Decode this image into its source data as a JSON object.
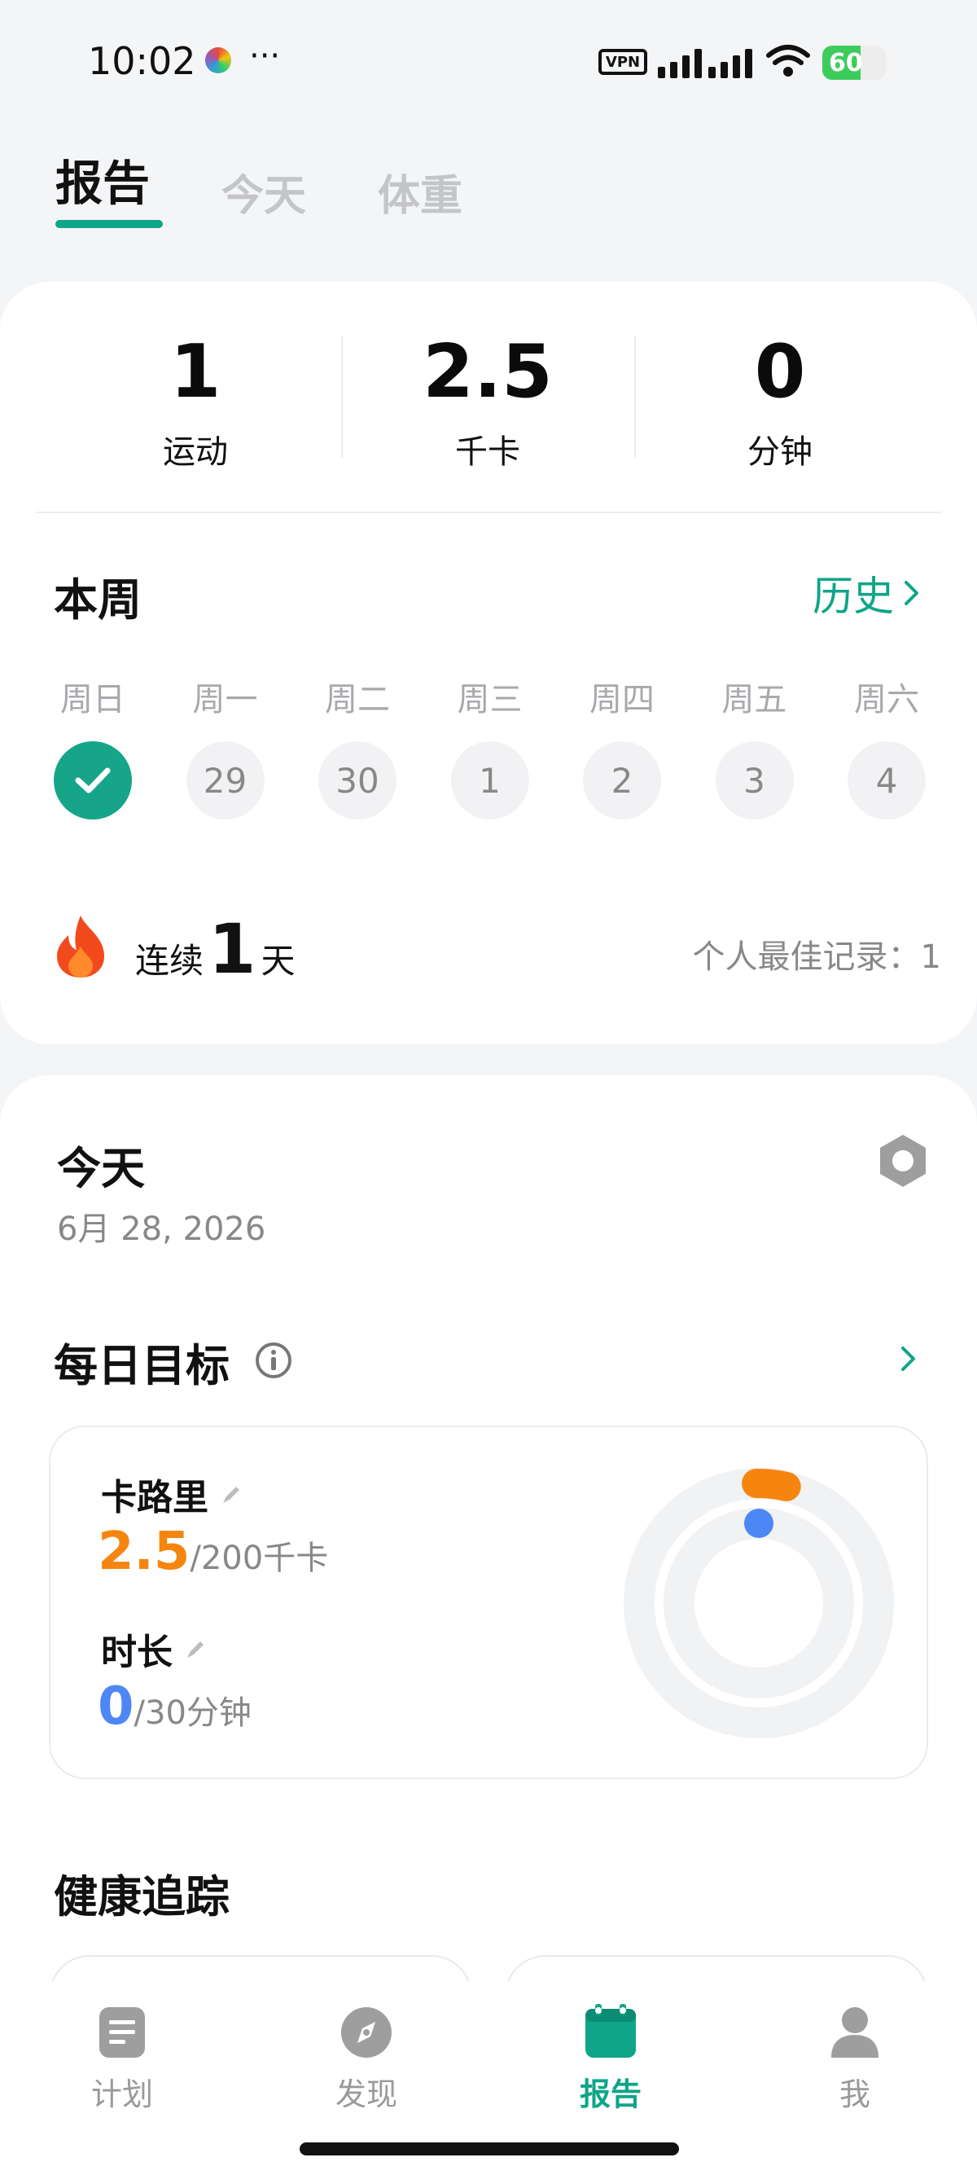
{
  "status_bar": {
    "time": "10:02",
    "dots": "···",
    "vpn": "VPN",
    "battery": "60",
    "battery_percent": 60
  },
  "tabs": [
    {
      "label": "报告",
      "active": true
    },
    {
      "label": "今天",
      "active": false
    },
    {
      "label": "体重",
      "active": false
    }
  ],
  "summary": {
    "stats": [
      {
        "value": "1",
        "label": "运动"
      },
      {
        "value": "2.5",
        "label": "千卡"
      },
      {
        "value": "0",
        "label": "分钟"
      }
    ]
  },
  "week": {
    "title": "本周",
    "history_label": "历史",
    "days": [
      {
        "label": "周日",
        "date": "",
        "done": true
      },
      {
        "label": "周一",
        "date": "29",
        "done": false
      },
      {
        "label": "周二",
        "date": "30",
        "done": false
      },
      {
        "label": "周三",
        "date": "1",
        "done": false
      },
      {
        "label": "周四",
        "date": "2",
        "done": false
      },
      {
        "label": "周五",
        "date": "3",
        "done": false
      },
      {
        "label": "周六",
        "date": "4",
        "done": false
      }
    ],
    "streak_prefix": "连续",
    "streak_count": "1",
    "streak_suffix": "天",
    "best_record": "个人最佳记录：1"
  },
  "today": {
    "title": "今天",
    "date": "6月 28, 2026"
  },
  "daily_goal": {
    "title": "每日目标",
    "calories": {
      "label": "卡路里",
      "value": "2.5",
      "target": "/200千卡",
      "progress": 0.0125,
      "color": "#F5850F"
    },
    "duration": {
      "label": "时长",
      "value": "0",
      "target": "/30分钟",
      "progress": 0,
      "color": "#4D86F5"
    }
  },
  "health": {
    "title": "健康追踪"
  },
  "nav": [
    {
      "label": "计划",
      "icon": "plan-icon",
      "active": false
    },
    {
      "label": "发现",
      "icon": "compass-icon",
      "active": false
    },
    {
      "label": "报告",
      "icon": "calendar-icon",
      "active": true
    },
    {
      "label": "我",
      "icon": "person-icon",
      "active": false
    }
  ],
  "colors": {
    "accent": "#0FA588",
    "orange": "#F5850F",
    "blue": "#4D86F5"
  }
}
